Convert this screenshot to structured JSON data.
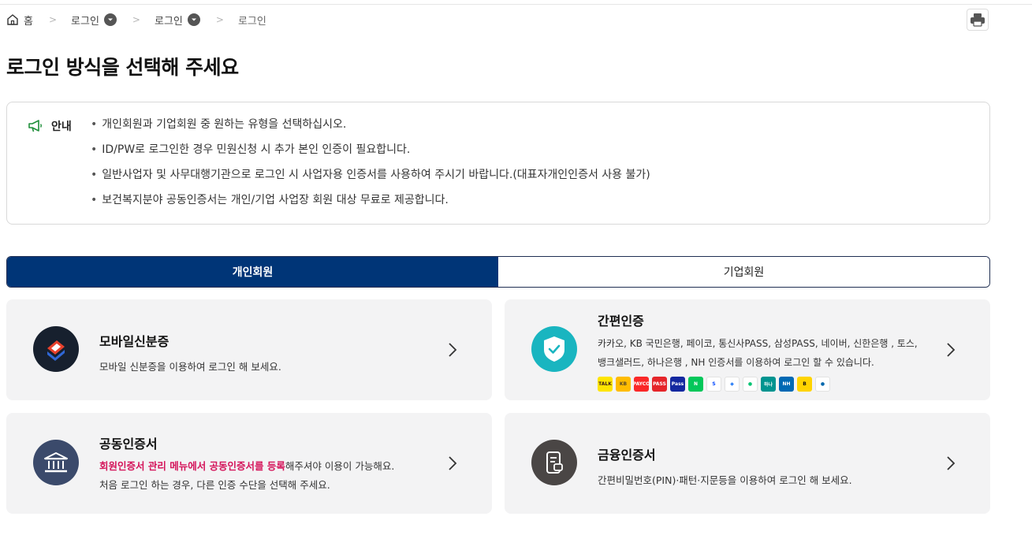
{
  "breadcrumb": {
    "home": "홈",
    "item1": "로그인",
    "item2": "로그인",
    "current": "로그인"
  },
  "page_title": "로그인 방식을 선택해 주세요",
  "notice": {
    "label": "안내",
    "items": [
      "개인회원과 기업회원 중 원하는 유형을 선택하십시오.",
      "ID/PW로 로그인한 경우 민원신청 시 추가 본인 인증이 필요합니다.",
      "일반사업자 및 사무대행기관으로 로그인 시 사업자용 인증서를 사용하여 주시기 바랍니다.(대표자개인인증서 사용 불가)",
      "보건복지분야 공동인증서는 개인/기업 사업장 회원 대상 무료로 제공합니다."
    ]
  },
  "tabs": [
    {
      "label": "개인회원",
      "active": true
    },
    {
      "label": "기업회원",
      "active": false
    }
  ],
  "cards": {
    "mobile_id": {
      "title": "모바일신분증",
      "desc": "모바일 신분증을 이용하여 로그인 해 보세요."
    },
    "simple_auth": {
      "title": "간편인증",
      "desc_line1": "카카오, KB 국민은행, 페이코, 통신사PASS, 삼성PASS, 네이버, 신한은행 , 토스,",
      "desc_line2": "뱅크샐러드, 하나은행 , NH 인증서를 이용하여 로그인 할 수 있습니다.",
      "logos": [
        {
          "name": "kakao",
          "color": "#fee500",
          "text": "TALK",
          "text_color": "#3c1e1e"
        },
        {
          "name": "kb",
          "color": "#ffbc00",
          "text": "KB",
          "text_color": "#5a4a2a"
        },
        {
          "name": "payco",
          "color": "#fa2828",
          "text": "PAYCO",
          "text_color": "#ffffff"
        },
        {
          "name": "pass",
          "color": "#e5252a",
          "text": "PASS",
          "text_color": "#ffffff"
        },
        {
          "name": "samsung-pass",
          "color": "#1428a0",
          "text": "Pass",
          "text_color": "#ffffff"
        },
        {
          "name": "naver",
          "color": "#03c75a",
          "text": "N",
          "text_color": "#ffffff"
        },
        {
          "name": "shinhan",
          "color": "#ffffff",
          "text": "S",
          "text_color": "#0046ff"
        },
        {
          "name": "toss",
          "color": "#ffffff",
          "text": "◆",
          "text_color": "#3182f6"
        },
        {
          "name": "banksalad",
          "color": "#ffffff",
          "text": "●",
          "text_color": "#00c473"
        },
        {
          "name": "hana",
          "color": "#009490",
          "text": "하나",
          "text_color": "#ffffff"
        },
        {
          "name": "nh",
          "color": "#0069b4",
          "text": "NH",
          "text_color": "#ffffff"
        },
        {
          "name": "b-cert",
          "color": "#ffd400",
          "text": "B",
          "text_color": "#111111"
        },
        {
          "name": "woori",
          "color": "#ffffff",
          "text": "●",
          "text_color": "#0067ac"
        }
      ]
    },
    "joint_cert": {
      "title": "공동인증서",
      "desc_highlight": "회원인증서 관리 메뉴에서 공동인증서를 등록",
      "desc_rest": "해주셔야 이용이 가능해요.",
      "desc_line2": "처음 로그인 하는 경우, 다른 인증 수단을 선택해 주세요."
    },
    "finance_cert": {
      "title": "금융인증서",
      "desc": "간편비밀번호(PIN)·패턴·지문등을 이용하여 로그인 해 보세요."
    }
  },
  "colors": {
    "primary": "#003577",
    "highlight": "#d4145a",
    "card_bg": "#f3f3f4",
    "simple_auth_icon": "#19b5c0",
    "joint_cert_icon": "#3b4a6b",
    "finance_cert_icon": "#4a4645"
  }
}
